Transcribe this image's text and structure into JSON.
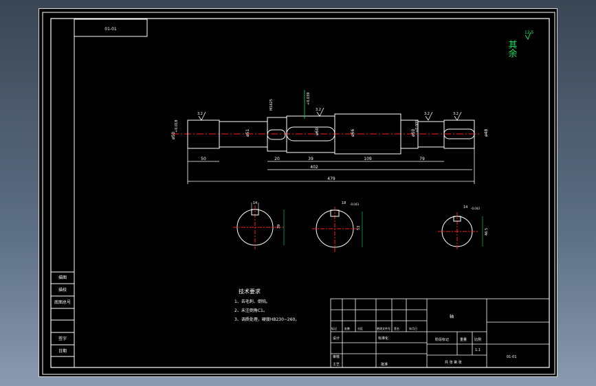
{
  "title_block_top": {
    "drawing_no_reversed": ""
  },
  "finish_note": {
    "label": "其余",
    "roughness": "12.5"
  },
  "shaft": {
    "roughness_marks": [
      "3.2",
      "3.2",
      "3.2",
      "3.2"
    ],
    "diameters": [
      "ø50",
      "ø51",
      "ø60",
      "ø66",
      "ø50",
      "ø48"
    ],
    "tolerances": [
      "+0.018",
      "+0.009",
      "+0.039",
      "+0.060"
    ],
    "keyway_width": "M1625",
    "lengths": [
      "50",
      "20",
      "39",
      "109",
      "79"
    ],
    "length_subtotal": "402",
    "length_total": "479"
  },
  "sections": [
    {
      "width": "14",
      "depth": "39"
    },
    {
      "width": "18",
      "tol": "-0.043",
      "depth": "53"
    },
    {
      "width": "14",
      "tol": "-0.043",
      "depth": "46.5"
    }
  ],
  "tech_req": {
    "title": "技术要求",
    "items": [
      "1、去毛刺、倒钝。",
      "2、未注倒角C1。",
      "3、调质处理，硬度HB230~260。"
    ]
  },
  "left_panel": {
    "rows": [
      "描图",
      "描校",
      "底图总号",
      "",
      "签字",
      "日期"
    ]
  },
  "title_block": {
    "header": [
      "标记",
      "处数",
      "分区",
      "更改文件号",
      "签名",
      "年月日"
    ],
    "designer": "设计",
    "standard": "标准化",
    "stage_label": "阶段标记",
    "weight_label": "重量",
    "scale_label": "比例",
    "scale": "1:1",
    "sheet": "共  张  第  张",
    "part_name": "轴",
    "company": "",
    "drawing_no": "01-01",
    "checker": "审核",
    "process": "工艺",
    "approve": "批准"
  }
}
